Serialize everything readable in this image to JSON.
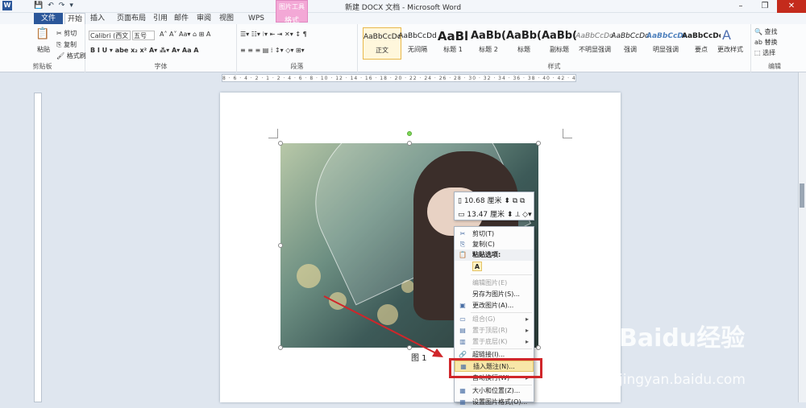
{
  "window": {
    "title": "新建 DOCX 文档 - Microsoft Word",
    "app_icon": "W"
  },
  "qat": {
    "save": "💾",
    "undo": "↶",
    "redo": "↷",
    "customize": "▾"
  },
  "contextual_tab": {
    "group": "图片工具",
    "tab": "格式"
  },
  "tabs": [
    "文件",
    "开始",
    "插入",
    "页面布局",
    "引用",
    "邮件",
    "审阅",
    "视图",
    "WPS PDF"
  ],
  "ribbon": {
    "clipboard": {
      "label": "剪贴板",
      "paste": "粘贴",
      "cut": "剪切",
      "copy": "复制",
      "format_painter": "格式刷"
    },
    "font": {
      "label": "字体",
      "font_name": "Calibri (西文",
      "font_size": "五号"
    },
    "paragraph": {
      "label": "段落"
    },
    "styles": {
      "label": "样式",
      "items": [
        {
          "preview": "AaBbCcDd",
          "name": "正文"
        },
        {
          "preview": "AaBbCcDd",
          "name": "无间隔"
        },
        {
          "preview": "AaBl",
          "name": "标题 1"
        },
        {
          "preview": "AaBb(",
          "name": "标题 2"
        },
        {
          "preview": "AaBb(",
          "name": "标题"
        },
        {
          "preview": "AaBb(",
          "name": "副标题"
        },
        {
          "preview": "AaBbCcDd",
          "name": "不明显强调"
        },
        {
          "preview": "AaBbCcDd",
          "name": "强调"
        },
        {
          "preview": "AaBbCcDc",
          "name": "明显强调"
        },
        {
          "preview": "AaBbCcDc",
          "name": "要点"
        }
      ],
      "change_styles": "更改样式"
    },
    "editing": {
      "label": "编辑",
      "find": "查找",
      "replace": "替换",
      "select": "选择"
    }
  },
  "ruler": "8 · 6 · 4 · 2 · 1 · 2 · 4 · 6 · 8 · 10 · 12 · 14 · 16 · 18 · 20 · 22 · 24 · 26 · 28 · 30 · 32 · 34 · 36 · 38 · 40 · 42 · 44",
  "mini_toolbar": {
    "height": "10.68 厘米",
    "width": "13.47 厘米"
  },
  "context_menu": {
    "items": [
      {
        "label": "剪切(T)",
        "icon": "✂",
        "disabled": false
      },
      {
        "label": "复制(C)",
        "icon": "⎘",
        "disabled": false
      },
      {
        "label": "粘贴选项:",
        "icon": "📋",
        "disabled": false,
        "bold": true
      },
      {
        "label": "编辑图片(E)",
        "icon": "",
        "disabled": true
      },
      {
        "label": "另存为图片(S)...",
        "icon": "",
        "disabled": false
      },
      {
        "label": "更改图片(A)...",
        "icon": "▣",
        "disabled": false
      },
      {
        "label": "组合(G)",
        "icon": "▭",
        "disabled": true,
        "submenu": true
      },
      {
        "label": "置于顶层(R)",
        "icon": "▤",
        "disabled": true,
        "submenu": true
      },
      {
        "label": "置于底层(K)",
        "icon": "▥",
        "disabled": true,
        "submenu": true
      },
      {
        "label": "超链接(I)...",
        "icon": "🔗",
        "disabled": false
      },
      {
        "label": "插入题注(N)...",
        "icon": "▦",
        "disabled": false,
        "highlighted": true
      },
      {
        "label": "自动换行(W)",
        "icon": "",
        "disabled": false,
        "submenu": true
      },
      {
        "label": "大小和位置(Z)...",
        "icon": "▦",
        "disabled": false
      },
      {
        "label": "设置图片格式(O)...",
        "icon": "▦",
        "disabled": false
      }
    ],
    "paste_option": "A"
  },
  "document": {
    "caption": "图  1"
  },
  "watermark": {
    "brand": "Baidu经验",
    "url": "jingyan.baidu.com"
  },
  "colors": {
    "accent": "#2b579a",
    "highlight_box": "#d0262a",
    "arrow": "#d0262a",
    "context_tab": "#f3a8d6"
  }
}
